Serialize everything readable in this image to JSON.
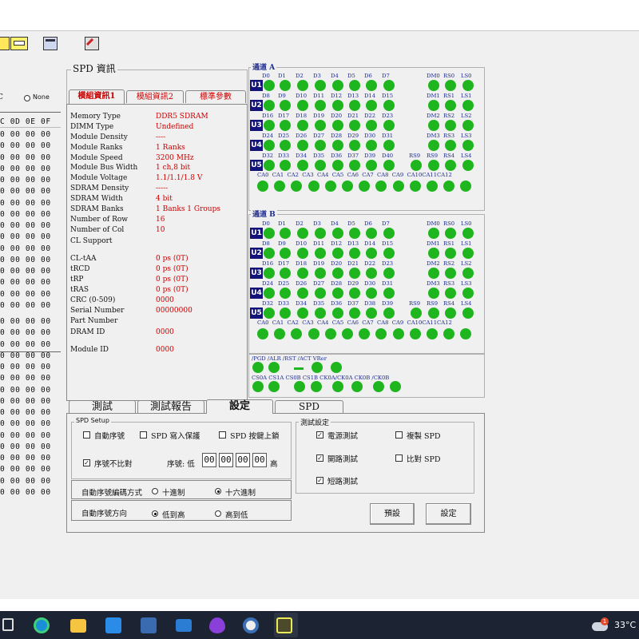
{
  "toolbar": {
    "icons": [
      "device-icon",
      "grid-icon",
      "window-icon",
      "tool-icon"
    ]
  },
  "left": {
    "radio_none": "None",
    "radio_left": "C",
    "hex_header": "C 0D 0E 0F",
    "hex_rows": [
      "0 00 00 00",
      "0 00 00 00",
      "0 00 00 00",
      "0 00 00 00",
      "0 00 00 00",
      "0 00 00 00",
      "0 00 00 00",
      "0 00 00 00",
      "0 00 00 00",
      "0 00 00 00",
      "0 00 00 00",
      "0 00 00 00",
      "0 00 00 00",
      "0 00 00 00",
      "0 00 00 00",
      "0 00 00 00",
      "0 00 00 00",
      "0 00 00 00",
      "0 00 00 00",
      "0 00 00 00",
      "0 00 00 00",
      "0 00 00 00",
      "0 00 00 00",
      "0 00 00 00",
      "0 00 00 00",
      "0 00 00 00",
      "0 00 00 00",
      "0 00 00 00",
      "0 00 00 00",
      "0 00 00 00",
      "0 00 00 00",
      "0 00 00 00"
    ]
  },
  "spd": {
    "title": "SPD 資訊",
    "tabs": [
      "模組資訊1",
      "模組資訊2",
      "標準參數"
    ],
    "fields": [
      {
        "label": "Memory Type",
        "value": "DDR5 SDRAM"
      },
      {
        "label": "DIMM Type",
        "value": "Undefined"
      },
      {
        "label": "Module Density",
        "value": "----"
      },
      {
        "label": "Module Ranks",
        "value": "1 Ranks"
      },
      {
        "label": "Module Speed",
        "value": "3200 MHz"
      },
      {
        "label": "Module Bus Width",
        "value": "1 ch,8 bit"
      },
      {
        "label": "Module Voltage",
        "value": "1.1/1.1/1.8 V"
      },
      {
        "label": "SDRAM Density",
        "value": "-----"
      },
      {
        "label": "SDRAM Width",
        "value": "4 bit"
      },
      {
        "label": "SDRAM Banks",
        "value": "1 Banks 1 Groups"
      },
      {
        "label": "Number of Row",
        "value": "16"
      },
      {
        "label": "Number of Col",
        "value": "10"
      },
      {
        "label": "CL Support",
        "value": ""
      },
      {
        "label": "CL-tAA",
        "value": "0 ps (0T)"
      },
      {
        "label": "tRCD",
        "value": "0 ps (0T)"
      },
      {
        "label": "tRP",
        "value": "0 ps (0T)"
      },
      {
        "label": "tRAS",
        "value": "0 ps (0T)"
      },
      {
        "label": "CRC (0-509)",
        "value": "0000"
      },
      {
        "label": "Serial Number",
        "value": "00000000"
      },
      {
        "label": "Part Number",
        "value": ""
      },
      {
        "label": "DRAM ID",
        "value": "0000"
      },
      {
        "label": "Module  ID",
        "value": "0000"
      }
    ]
  },
  "channel_a": {
    "title": "通道 A",
    "rows": [
      {
        "unit": "U1",
        "labels": [
          "D0",
          "D1",
          "D2",
          "D3",
          "D4",
          "D5",
          "D6",
          "D7",
          "DM0",
          "RS0",
          "LS0"
        ]
      },
      {
        "unit": "U2",
        "labels": [
          "D8",
          "D9",
          "D10",
          "D11",
          "D12",
          "D13",
          "D14",
          "D15",
          "DM1",
          "RS1",
          "LS1"
        ]
      },
      {
        "unit": "U3",
        "labels": [
          "D16",
          "D17",
          "D18",
          "D19",
          "D20",
          "D21",
          "D22",
          "D23",
          "DM2",
          "RS2",
          "LS2"
        ]
      },
      {
        "unit": "U4",
        "labels": [
          "D24",
          "D25",
          "D26",
          "D27",
          "D28",
          "D29",
          "D30",
          "D31",
          "DM3",
          "RS3",
          "LS3"
        ]
      },
      {
        "unit": "U5",
        "labels": [
          "D32",
          "D33",
          "D34",
          "D35",
          "D36",
          "D37",
          "D39",
          "D40",
          "RS9",
          "RS9",
          "RS4",
          "LS4"
        ]
      }
    ],
    "ca_labels": "CA0  CA1  CA2  CA3  CA4  CA5  CA6  CA7  CA8  CA9  CA10CA11CA12"
  },
  "channel_b": {
    "title": "通道 B",
    "rows": [
      {
        "unit": "U1",
        "labels": [
          "D0",
          "D1",
          "D2",
          "D3",
          "D4",
          "D5",
          "D6",
          "D7",
          "DM0",
          "RS0",
          "LS0"
        ]
      },
      {
        "unit": "U2",
        "labels": [
          "D8",
          "D9",
          "D10",
          "D11",
          "D12",
          "D13",
          "D14",
          "D15",
          "DM1",
          "RS1",
          "LS1"
        ]
      },
      {
        "unit": "U3",
        "labels": [
          "D16",
          "D17",
          "D18",
          "D19",
          "D20",
          "D21",
          "D22",
          "D23",
          "DM2",
          "RS2",
          "LS2"
        ]
      },
      {
        "unit": "U4",
        "labels": [
          "D24",
          "D25",
          "D26",
          "D27",
          "D28",
          "D29",
          "D30",
          "D31",
          "DM3",
          "RS3",
          "LS3"
        ]
      },
      {
        "unit": "U5",
        "labels": [
          "D32",
          "D33",
          "D34",
          "D35",
          "D36",
          "D37",
          "D38",
          "D39",
          "RS9",
          "RS9",
          "RS4",
          "LS4"
        ]
      }
    ],
    "ca_labels": "CA0  CA1  CA2  CA3  CA4  CA5  CA6  CA7  CA8  CA9  CA10CA11CA12"
  },
  "signals": {
    "row1": "/PGD /ALR  /RST  /ACT  VRer",
    "row2": "CS0A CS1A  CS0B  CS1B  CK0A/CK0A  CK0B /CK0B"
  },
  "bottom_tabs": [
    "測試",
    "測試報告",
    "設定",
    "SPD"
  ],
  "spd_setup": {
    "title": "SPD Setup",
    "auto_serial": "自動序號",
    "spd_write_protect": "SPD 寫入保護",
    "spd_lock": "SPD 按鍵上鎖",
    "serial_nomatch": "序號不比對",
    "serial_label": "序號: 低",
    "serial_values": [
      "00",
      "00",
      "00",
      "00"
    ],
    "serial_high": "高",
    "encoding_label": "自動序號編碼方式",
    "decimal": "十進制",
    "hex": "十六進制",
    "direction_label": "自動序號方向",
    "low_to_high": "低到高",
    "high_to_low": "高到低"
  },
  "test_setup": {
    "title": "測試設定",
    "power": "電源測試",
    "open": "開路測試",
    "short": "短路測試",
    "copy_spd": "複製 SPD",
    "compare_spd": "比對 SPD",
    "default_btn": "預設",
    "set_btn": "設定"
  },
  "taskbar": {
    "weather": "33°C",
    "alert_count": "1"
  }
}
